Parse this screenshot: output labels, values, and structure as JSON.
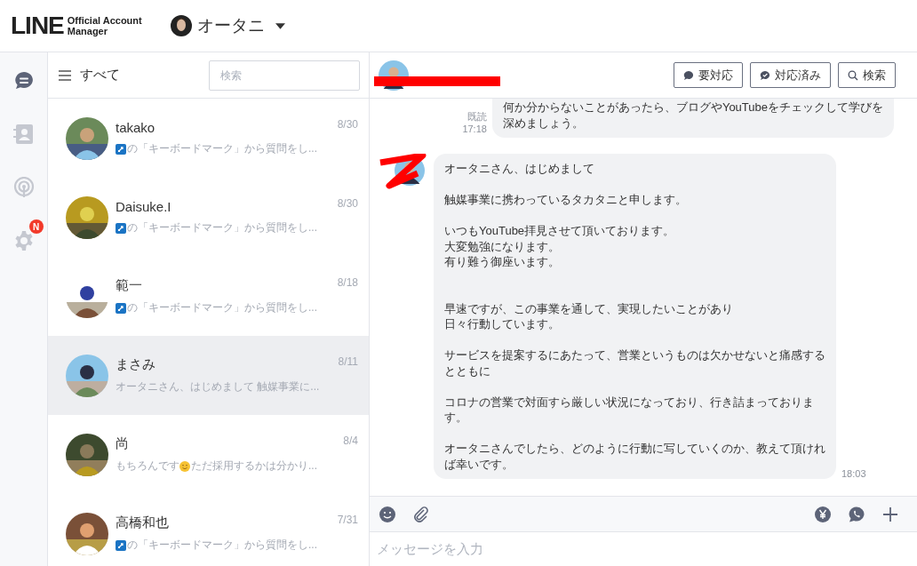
{
  "header": {
    "logo": "LINE",
    "logo_sub": [
      "Official Account",
      "Manager"
    ],
    "account_name": "オータニ"
  },
  "rail": [
    {
      "selected": true
    },
    {
      "selected": false
    },
    {
      "selected": false
    },
    {
      "selected": false,
      "badge": "N"
    }
  ],
  "list": {
    "filter": "すべて",
    "search": {
      "placeholder": "検索"
    },
    "items": [
      {
        "name": "takako",
        "date": "8/30",
        "selected": false,
        "preview": [
          {
            "kind": "badge"
          },
          {
            "kind": "text",
            "text": "の「キーボードマーク」から質問をし..."
          }
        ]
      },
      {
        "name": "Daisuke.I",
        "date": "8/30",
        "selected": false,
        "preview": [
          {
            "kind": "badge"
          },
          {
            "kind": "text",
            "text": "の「キーボードマーク」から質問をし..."
          }
        ]
      },
      {
        "name": "範一",
        "date": "8/18",
        "selected": false,
        "preview": [
          {
            "kind": "badge"
          },
          {
            "kind": "text",
            "text": "の「キーボードマーク」から質問をし..."
          }
        ]
      },
      {
        "name": "まさみ",
        "date": "8/11",
        "selected": true,
        "preview": [
          {
            "kind": "text",
            "text": "オータニさん、はじめまして 触媒事業に..."
          }
        ]
      },
      {
        "name": "尚",
        "date": "8/4",
        "selected": false,
        "preview": [
          {
            "kind": "text",
            "text": "もちろんです"
          },
          {
            "kind": "emoji"
          },
          {
            "kind": "text",
            "text": " ただ採用するかは分かり..."
          }
        ]
      },
      {
        "name": "高橋和也",
        "date": "7/31",
        "selected": false,
        "preview": [
          {
            "kind": "badge"
          },
          {
            "kind": "text",
            "text": "の「キーボードマーク」から質問をし..."
          }
        ]
      }
    ]
  },
  "chat": {
    "buttons": [
      {
        "label": "要対応"
      },
      {
        "label": "対応済み"
      },
      {
        "label": "検索"
      }
    ],
    "messages": [
      {
        "kind": "sent",
        "status": "既読",
        "time": "17:18",
        "paragraphs": [
          {
            "lines": [
              "何か分からないことがあったら、ブログやYouTubeをチェックして学びを",
              "深めましょう。"
            ]
          }
        ]
      },
      {
        "kind": "received",
        "time": "18:03",
        "paragraphs": [
          {
            "lines": [
              "オータニさん、はじめまして"
            ]
          },
          {
            "lines": [
              "触媒事業に携わっているタカタニと申します。"
            ]
          },
          {
            "lines": [
              "いつもYouTube拝見させて頂いております。",
              "大変勉強になります。",
              "有り難う御座います。"
            ]
          },
          {
            "extra_space": true,
            "lines": [
              "早速ですが、この事業を通して、実現したいことがあり",
              "日々行動しています。"
            ]
          },
          {
            "lines": [
              "サービスを提案するにあたって、営業というものは欠かせないと痛感する",
              "とともに"
            ]
          },
          {
            "lines": [
              "コロナの営業で対面すら厳しい状況になっており、行き詰まっておりま",
              "す。"
            ]
          },
          {
            "lines": [
              "オータニさんでしたら、どのように行動に写していくのか、教えて頂けれ",
              "ば幸いです。"
            ]
          }
        ]
      }
    ],
    "input": {
      "placeholder": "メッセージを入力"
    }
  }
}
